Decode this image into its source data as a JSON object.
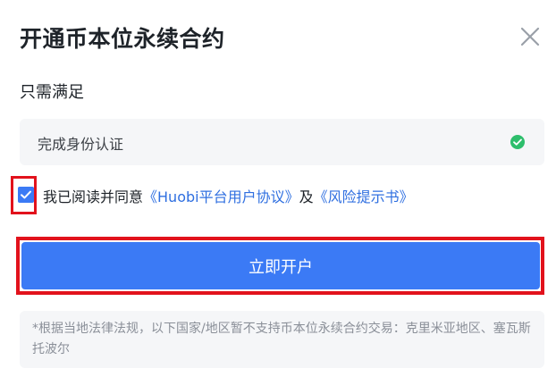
{
  "dialog": {
    "title": "开通币本位永续合约",
    "close_icon": "close-icon"
  },
  "requirements": {
    "heading": "只需满足",
    "items": [
      {
        "label": "完成身份认证",
        "status_icon": "check-circle-icon",
        "status_color": "#2dbe6c"
      }
    ]
  },
  "agreement": {
    "checked": true,
    "prefix": "我已阅读并同意",
    "user_agreement_link": "《Huobi平台用户协议》",
    "joiner": "及",
    "risk_link": "《风险提示书》"
  },
  "open_button": {
    "label": "立即开户"
  },
  "notice": {
    "text": "*根据当地法律法规，以下国家/地区暂不支持币本位永续合约交易：克里米亚地区、塞瓦斯托波尔"
  },
  "colors": {
    "accent": "#3b7af5",
    "link": "#2f6fe0",
    "success": "#2dbe6c",
    "highlight": "#e2121c"
  }
}
